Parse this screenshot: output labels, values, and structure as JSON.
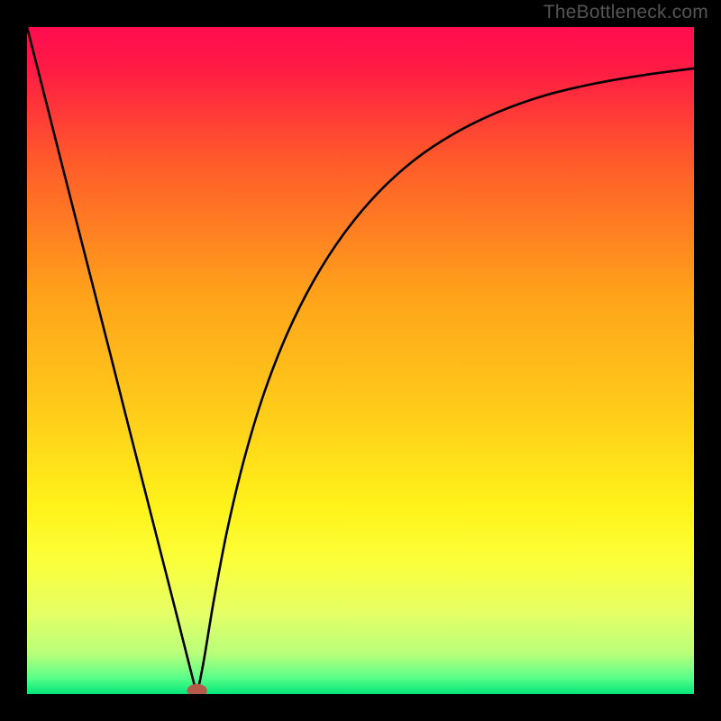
{
  "watermark": "TheBottleneck.com",
  "chart_data": {
    "type": "line",
    "title": "",
    "xlabel": "",
    "ylabel": "",
    "xlim": [
      0,
      1
    ],
    "ylim": [
      0,
      1
    ],
    "background_gradient": {
      "stops": [
        {
          "offset": 0.0,
          "color": "#ff0d4f"
        },
        {
          "offset": 0.06,
          "color": "#ff1a45"
        },
        {
          "offset": 0.2,
          "color": "#ff5a2a"
        },
        {
          "offset": 0.4,
          "color": "#ffa21a"
        },
        {
          "offset": 0.6,
          "color": "#ffd21a"
        },
        {
          "offset": 0.72,
          "color": "#fff31a"
        },
        {
          "offset": 0.8,
          "color": "#fbff3a"
        },
        {
          "offset": 0.88,
          "color": "#e5ff66"
        },
        {
          "offset": 0.94,
          "color": "#b8ff7a"
        },
        {
          "offset": 0.975,
          "color": "#5cff8a"
        },
        {
          "offset": 1.0,
          "color": "#05e67a"
        }
      ]
    },
    "marker": {
      "x": 0.255,
      "y": 0.005,
      "rx": 0.015,
      "ry": 0.01,
      "color": "#b45a4a"
    },
    "series": [
      {
        "name": "left-branch",
        "x": [
          0.0,
          0.025,
          0.05,
          0.075,
          0.1,
          0.125,
          0.15,
          0.175,
          0.2,
          0.225,
          0.25
        ],
        "y": [
          1.0,
          0.902,
          0.803,
          0.705,
          0.607,
          0.509,
          0.41,
          0.312,
          0.214,
          0.116,
          0.017
        ]
      },
      {
        "name": "right-branch",
        "x": [
          0.255,
          0.265,
          0.28,
          0.3,
          0.325,
          0.355,
          0.39,
          0.43,
          0.475,
          0.525,
          0.58,
          0.64,
          0.705,
          0.775,
          0.85,
          0.925,
          1.0
        ],
        "y": [
          0.003,
          0.05,
          0.14,
          0.245,
          0.35,
          0.45,
          0.54,
          0.62,
          0.69,
          0.75,
          0.8,
          0.84,
          0.872,
          0.897,
          0.915,
          0.928,
          0.938
        ]
      }
    ]
  }
}
